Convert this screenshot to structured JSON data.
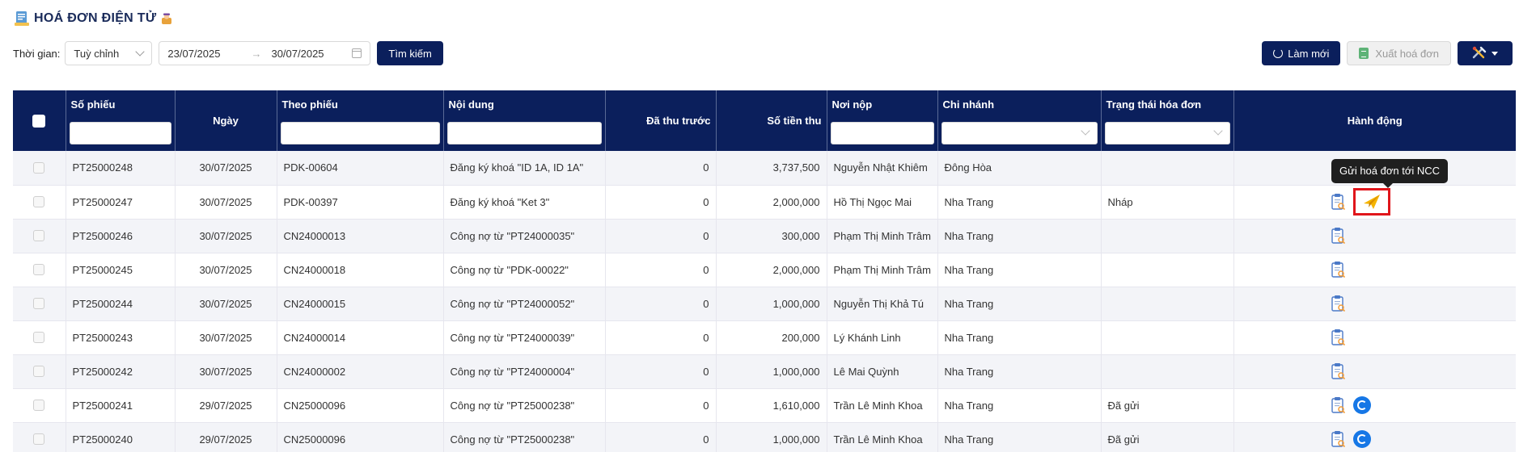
{
  "page": {
    "title": "HOÁ ĐƠN ĐIỆN TỬ",
    "icons": {
      "title_icon": "invoice-doc-icon",
      "emoji": "person-emoji-icon"
    }
  },
  "toolbar": {
    "time_label": "Thời gian:",
    "time_select_value": "Tuỳ chỉnh",
    "date_from": "23/07/2025",
    "date_to": "30/07/2025",
    "search_label": "Tìm kiếm",
    "refresh_label": "Làm mới",
    "export_label": "Xuất hoá đơn"
  },
  "table": {
    "headers": {
      "so_phieu": "Số phiếu",
      "ngay": "Ngày",
      "theo_phieu": "Theo phiếu",
      "noi_dung": "Nội dung",
      "da_thu_truoc": "Đã thu trước",
      "so_tien_thu": "Số tiền thu",
      "noi_nop": "Nơi nộp",
      "chi_nhanh": "Chi nhánh",
      "trang_thai": "Trạng thái hóa đơn",
      "hanh_dong": "Hành động"
    },
    "rows": [
      {
        "so_phieu": "PT25000248",
        "ngay": "30/07/2025",
        "theo_phieu": "PDK-00604",
        "noi_dung": "Đăng ký khoá \"ID 1A, ID 1A\"",
        "da_thu_truoc": "0",
        "so_tien_thu": "3,737,500",
        "noi_nop": "Nguyễn Nhật Khiêm",
        "chi_nhanh": "Đông Hòa",
        "trang_thai": ""
      },
      {
        "so_phieu": "PT25000247",
        "ngay": "30/07/2025",
        "theo_phieu": "PDK-00397",
        "noi_dung": "Đăng ký khoá \"Ket 3\"",
        "da_thu_truoc": "0",
        "so_tien_thu": "2,000,000",
        "noi_nop": "Hồ Thị Ngọc Mai",
        "chi_nhanh": "Nha Trang",
        "trang_thai": "Nháp"
      },
      {
        "so_phieu": "PT25000246",
        "ngay": "30/07/2025",
        "theo_phieu": "CN24000013",
        "noi_dung": "Công nợ từ \"PT24000035\"",
        "da_thu_truoc": "0",
        "so_tien_thu": "300,000",
        "noi_nop": "Phạm Thị Minh Trâm",
        "chi_nhanh": "Nha Trang",
        "trang_thai": ""
      },
      {
        "so_phieu": "PT25000245",
        "ngay": "30/07/2025",
        "theo_phieu": "CN24000018",
        "noi_dung": "Công nợ từ \"PDK-00022\"",
        "da_thu_truoc": "0",
        "so_tien_thu": "2,000,000",
        "noi_nop": "Phạm Thị Minh Trâm",
        "chi_nhanh": "Nha Trang",
        "trang_thai": ""
      },
      {
        "so_phieu": "PT25000244",
        "ngay": "30/07/2025",
        "theo_phieu": "CN24000015",
        "noi_dung": "Công nợ từ \"PT24000052\"",
        "da_thu_truoc": "0",
        "so_tien_thu": "1,000,000",
        "noi_nop": "Nguyễn Thị Khả Tú",
        "chi_nhanh": "Nha Trang",
        "trang_thai": ""
      },
      {
        "so_phieu": "PT25000243",
        "ngay": "30/07/2025",
        "theo_phieu": "CN24000014",
        "noi_dung": "Công nợ từ \"PT24000039\"",
        "da_thu_truoc": "0",
        "so_tien_thu": "200,000",
        "noi_nop": "Lý Khánh Linh",
        "chi_nhanh": "Nha Trang",
        "trang_thai": ""
      },
      {
        "so_phieu": "PT25000242",
        "ngay": "30/07/2025",
        "theo_phieu": "CN24000002",
        "noi_dung": "Công nợ từ \"PT24000004\"",
        "da_thu_truoc": "0",
        "so_tien_thu": "1,000,000",
        "noi_nop": "Lê Mai Quỳnh",
        "chi_nhanh": "Nha Trang",
        "trang_thai": ""
      },
      {
        "so_phieu": "PT25000241",
        "ngay": "29/07/2025",
        "theo_phieu": "CN25000096",
        "noi_dung": "Công nợ từ \"PT25000238\"",
        "da_thu_truoc": "0",
        "so_tien_thu": "1,610,000",
        "noi_nop": "Trần Lê Minh Khoa",
        "chi_nhanh": "Nha Trang",
        "trang_thai": "Đã gửi"
      },
      {
        "so_phieu": "PT25000240",
        "ngay": "29/07/2025",
        "theo_phieu": "CN25000096",
        "noi_dung": "Công nợ từ \"PT25000238\"",
        "da_thu_truoc": "0",
        "so_tien_thu": "1,000,000",
        "noi_nop": "Trần Lê Minh Khoa",
        "chi_nhanh": "Nha Trang",
        "trang_thai": "Đã gửi"
      }
    ]
  },
  "tooltip": {
    "text": "Gửi hoá đơn tới NCC"
  },
  "colors": {
    "header_bg": "#0b1f5c",
    "highlight_border": "#e0151b",
    "sync_blue": "#1677e6",
    "send_yellow": "#f5b400"
  }
}
